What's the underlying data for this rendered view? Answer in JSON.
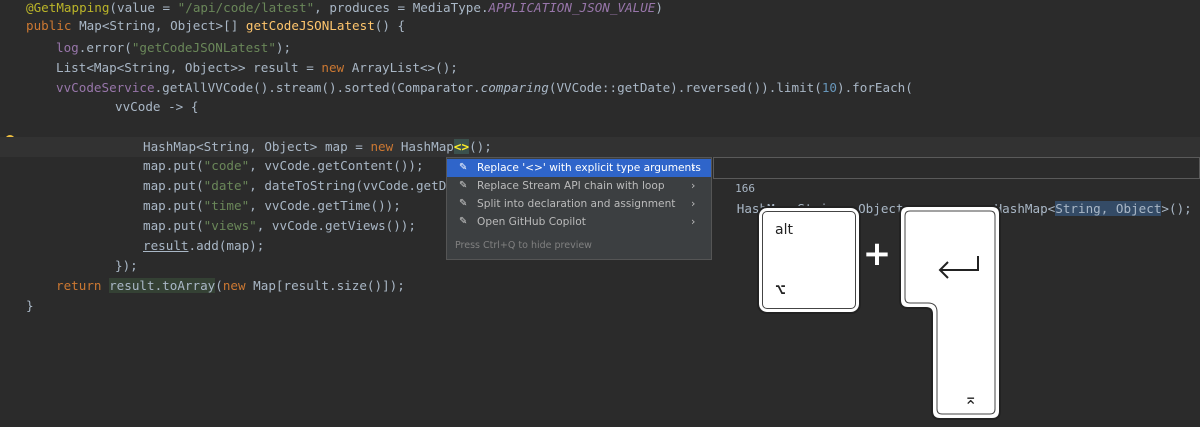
{
  "editor": {
    "lines": [
      {
        "segments": [
          [
            "ann",
            "@GetMapping"
          ],
          [
            "var",
            "("
          ],
          [
            "var",
            "value = "
          ],
          [
            "str",
            "\"/api/code/latest\""
          ],
          [
            "var",
            ", produces = MediaType."
          ],
          [
            "cst",
            "APPLICATION_JSON_VALUE"
          ],
          [
            "var",
            ")"
          ]
        ]
      },
      {
        "segments": [
          [
            "kw",
            "public "
          ],
          [
            "var",
            "Map<String, Object>[] "
          ],
          [
            "mcall",
            "getCodeJSONLatest"
          ],
          [
            "var",
            "() {"
          ]
        ]
      },
      {
        "segments": [
          [
            "fld",
            "log"
          ],
          [
            "var",
            "."
          ],
          [
            "var",
            "error("
          ],
          [
            "str",
            "\"getCodeJSONLatest\""
          ],
          [
            "var",
            ");"
          ]
        ]
      },
      {
        "segments": [
          [
            "var",
            "List<Map<String, Object>> result = "
          ],
          [
            "kw",
            "new "
          ],
          [
            "var",
            "ArrayList<>();"
          ]
        ]
      },
      {
        "segments": [
          [
            "fld",
            "vvCodeService"
          ],
          [
            "var",
            ".getAllVVCode().stream().sorted(Comparator."
          ],
          [
            "it",
            "comparing"
          ],
          [
            "var",
            "(VVCode::getDate).reversed()).limit("
          ],
          [
            "num",
            "10"
          ],
          [
            "var",
            ").forEach("
          ]
        ]
      },
      {
        "segments": [
          [
            "var",
            "vvCode -> {"
          ]
        ]
      },
      {
        "segments": []
      },
      {
        "segments": [
          [
            "var",
            "HashMap<String, Object> map = "
          ],
          [
            "kw",
            "new "
          ],
          [
            "var",
            "HashMap"
          ],
          [
            "dia",
            "<>"
          ],
          [
            "var",
            "();"
          ]
        ]
      },
      {
        "segments": [
          [
            "var",
            "map.put("
          ],
          [
            "str",
            "\"code\""
          ],
          [
            "var",
            ", vvCode.getContent());"
          ]
        ]
      },
      {
        "segments": [
          [
            "var",
            "map.put("
          ],
          [
            "str",
            "\"date\""
          ],
          [
            "var",
            ", dateToString(vvCode.getDat"
          ]
        ]
      },
      {
        "segments": [
          [
            "var",
            "map.put("
          ],
          [
            "str",
            "\"time\""
          ],
          [
            "var",
            ", vvCode.getTime());"
          ]
        ]
      },
      {
        "segments": [
          [
            "var",
            "map.put("
          ],
          [
            "str",
            "\"views\""
          ],
          [
            "var",
            ", vvCode.getViews());"
          ]
        ]
      },
      {
        "segments": [
          [
            "ul",
            "result"
          ],
          [
            "var",
            ".add(map);"
          ]
        ]
      },
      {
        "segments": [
          [
            "var",
            "});"
          ]
        ]
      },
      {
        "segments": [
          [
            "kw",
            "return "
          ],
          [
            "ret",
            "result.toArray"
          ],
          [
            "var",
            "("
          ],
          [
            "kw",
            "new "
          ],
          [
            "var",
            "Map[result.size()]);"
          ]
        ]
      },
      {
        "segments": [
          [
            "var",
            "}"
          ]
        ]
      }
    ]
  },
  "popup": {
    "items": [
      {
        "label": "Replace '<>' with explicit type arguments",
        "icon": "pencil-icon",
        "selected": true
      },
      {
        "label": "Replace Stream API chain with loop",
        "icon": "pencil-icon",
        "selected": false
      },
      {
        "label": "Split into declaration and assignment",
        "icon": "pencil-icon",
        "selected": false
      },
      {
        "label": "Open GitHub Copilot",
        "icon": "pencil-icon",
        "selected": false
      }
    ],
    "hint": "Press Ctrl+Q to hide preview"
  },
  "preview": {
    "line_number": "166",
    "segments": [
      [
        "var",
        "HashMap<String, Object> map = "
      ],
      [
        "kw",
        "new "
      ],
      [
        "var",
        "HashMap<"
      ],
      [
        "tmp",
        "String, Object"
      ],
      [
        "var",
        ">();"
      ]
    ]
  },
  "shortcut": {
    "alt_label": "alt",
    "alt_symbol": "⌥",
    "plus": "+",
    "enter_icon": "return-arrow-icon",
    "enter_symbol": "⌅"
  },
  "colors": {
    "background": "#2b2b2b",
    "keyword": "#cc7832",
    "string": "#6a8759",
    "annotation": "#bbb529",
    "method": "#ffc66d",
    "selection": "#2f65ca"
  }
}
